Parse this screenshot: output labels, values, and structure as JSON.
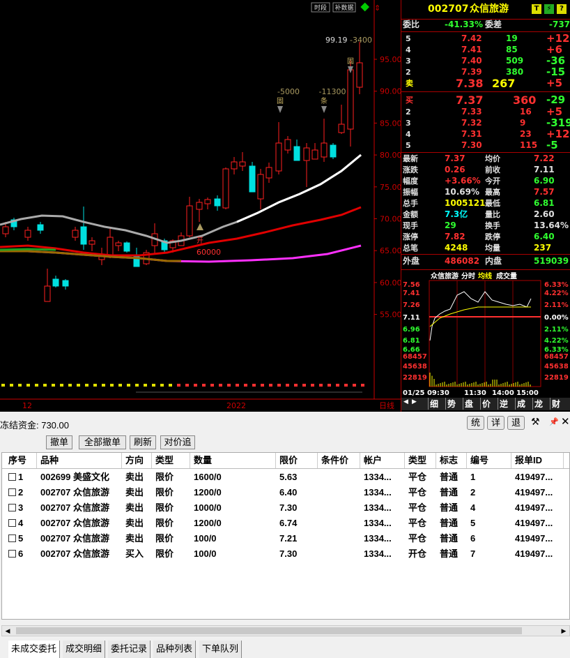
{
  "chart": {
    "buttons": [
      "时段",
      "补数据"
    ],
    "last_high": "99.19",
    "last_qty": "-3400",
    "annotations": [
      {
        "qty": "-5000",
        "tag": "固"
      },
      {
        "qty": "-11300",
        "tag": "条"
      },
      {
        "tag": "固"
      },
      {
        "tag": "开",
        "qty": "60000"
      }
    ],
    "price_ticks": [
      "95.00",
      "90.00",
      "85.00",
      "80.00",
      "75.00",
      "70.00",
      "65.00",
      "60.00",
      "55.00"
    ],
    "x_labels": [
      "12",
      "2022"
    ],
    "x_axis_caption": "日线"
  },
  "quote": {
    "code": "002707",
    "name": "众信旅游",
    "wei_bi_label": "委比",
    "wei_bi": "-41.33%",
    "wei_cha_label": "委差",
    "wei_cha": "-737",
    "sell": [
      {
        "lvl": "5",
        "price": "7.42",
        "vol": "19",
        "chg": "+12"
      },
      {
        "lvl": "4",
        "price": "7.41",
        "vol": "85",
        "chg": "+6"
      },
      {
        "lvl": "3",
        "price": "7.40",
        "vol": "509",
        "chg": "-36"
      },
      {
        "lvl": "2",
        "price": "7.39",
        "vol": "380",
        "chg": "-15"
      },
      {
        "lvl": "卖",
        "price": "7.38",
        "vol": "267",
        "chg": "+5"
      }
    ],
    "buy": [
      {
        "lvl": "买",
        "price": "7.37",
        "vol": "360",
        "chg": "-29"
      },
      {
        "lvl": "2",
        "price": "7.33",
        "vol": "16",
        "chg": "+5"
      },
      {
        "lvl": "3",
        "price": "7.32",
        "vol": "9",
        "chg": "-319"
      },
      {
        "lvl": "4",
        "price": "7.31",
        "vol": "23",
        "chg": "+12"
      },
      {
        "lvl": "5",
        "price": "7.30",
        "vol": "115",
        "chg": "-5"
      }
    ],
    "stats": [
      {
        "l1": "最新",
        "v1": "7.37",
        "c1": "r",
        "l2": "均价",
        "v2": "7.22",
        "c2": "r"
      },
      {
        "l1": "涨跌",
        "v1": "0.26",
        "c1": "r",
        "l2": "前收",
        "v2": "7.11",
        "c2": "w"
      },
      {
        "l1": "幅度",
        "v1": "+3.66%",
        "c1": "r",
        "l2": "今开",
        "v2": "6.90",
        "c2": "g"
      },
      {
        "l1": "振幅",
        "v1": "10.69%",
        "c1": "w",
        "l2": "最高",
        "v2": "7.57",
        "c2": "r"
      },
      {
        "l1": "总手",
        "v1": "1005121",
        "c1": "y",
        "l2": "最低",
        "v2": "6.81",
        "c2": "g"
      },
      {
        "l1": "金额",
        "v1": "7.3亿",
        "c1": "c",
        "l2": "量比",
        "v2": "2.60",
        "c2": "w"
      },
      {
        "l1": "现手",
        "v1": "29",
        "c1": "g",
        "l2": "换手",
        "v2": "13.64%",
        "c2": "w"
      },
      {
        "l1": "涨停",
        "v1": "7.82",
        "c1": "r",
        "l2": "跌停",
        "v2": "6.40",
        "c2": "g"
      },
      {
        "l1": "总笔",
        "v1": "4248",
        "c1": "y",
        "l2": "均量",
        "v2": "237",
        "c2": "y"
      }
    ],
    "outer_label": "外盘",
    "outer": "486082",
    "inner_label": "内盘",
    "inner": "519039",
    "mini_title": "众信旅游",
    "mini_tabs": [
      "分时",
      "均线",
      "成交量"
    ],
    "mini_left": [
      "7.56",
      "7.41",
      "7.26",
      "7.11",
      "6.96",
      "6.81",
      "6.66",
      "68457",
      "45638",
      "22819"
    ],
    "mini_right": [
      "6.33%",
      "4.22%",
      "2.11%",
      "0.00%",
      "2.11%",
      "4.22%",
      "6.33%",
      "68457",
      "45638",
      "22819"
    ],
    "mini_times": [
      "01/25 09:30",
      "11:30",
      "14:00",
      "15:00"
    ],
    "side_tabs": [
      "细",
      "势",
      "盘",
      "价",
      "逆",
      "成",
      "龙",
      "财"
    ]
  },
  "order": {
    "frozen": "冻结资金: 730.00",
    "right_buttons": [
      "统",
      "详",
      "退"
    ],
    "buttons": [
      "撤单",
      "全部撤单",
      "刷新",
      "对价追"
    ],
    "columns": [
      "序号",
      "品种",
      "方向",
      "类型",
      "数量",
      "限价",
      "条件价",
      "帐户",
      "类型",
      "标志",
      "编号",
      "报单ID"
    ],
    "rows": [
      [
        "1",
        "002699 美盛文化",
        "卖出",
        "限价",
        "1600/0",
        "5.63",
        "",
        "1334...",
        "平仓",
        "普通",
        "1",
        "419497..."
      ],
      [
        "2",
        "002707 众信旅游",
        "卖出",
        "限价",
        "1200/0",
        "6.40",
        "",
        "1334...",
        "平仓",
        "普通",
        "2",
        "419497..."
      ],
      [
        "3",
        "002707 众信旅游",
        "卖出",
        "限价",
        "1000/0",
        "7.30",
        "",
        "1334...",
        "平仓",
        "普通",
        "4",
        "419497..."
      ],
      [
        "4",
        "002707 众信旅游",
        "卖出",
        "限价",
        "1200/0",
        "6.74",
        "",
        "1334...",
        "平仓",
        "普通",
        "5",
        "419497..."
      ],
      [
        "5",
        "002707 众信旅游",
        "卖出",
        "限价",
        "100/0",
        "7.21",
        "",
        "1334...",
        "平仓",
        "普通",
        "6",
        "419497..."
      ],
      [
        "6",
        "002707 众信旅游",
        "买入",
        "限价",
        "100/0",
        "7.30",
        "",
        "1334...",
        "开仓",
        "普通",
        "7",
        "419497..."
      ]
    ],
    "tabs": [
      "未成交委托",
      "成交明细",
      "委托记录",
      "品种列表",
      "下单队列"
    ]
  }
}
